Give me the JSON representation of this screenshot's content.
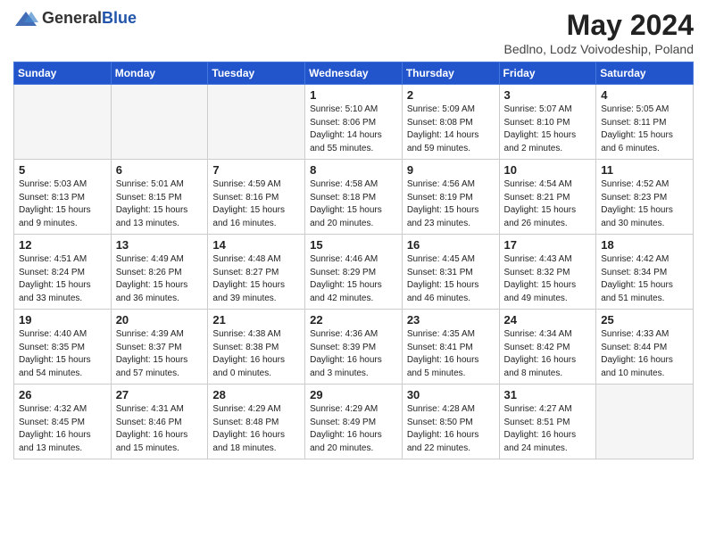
{
  "header": {
    "logo_general": "General",
    "logo_blue": "Blue",
    "month_year": "May 2024",
    "location": "Bedlno, Lodz Voivodeship, Poland"
  },
  "weekdays": [
    "Sunday",
    "Monday",
    "Tuesday",
    "Wednesday",
    "Thursday",
    "Friday",
    "Saturday"
  ],
  "weeks": [
    [
      {
        "day": "",
        "sunrise": "",
        "sunset": "",
        "daylight": "",
        "empty": true
      },
      {
        "day": "",
        "sunrise": "",
        "sunset": "",
        "daylight": "",
        "empty": true
      },
      {
        "day": "",
        "sunrise": "",
        "sunset": "",
        "daylight": "",
        "empty": true
      },
      {
        "day": "1",
        "sunrise": "Sunrise: 5:10 AM",
        "sunset": "Sunset: 8:06 PM",
        "daylight": "Daylight: 14 hours and 55 minutes.",
        "empty": false
      },
      {
        "day": "2",
        "sunrise": "Sunrise: 5:09 AM",
        "sunset": "Sunset: 8:08 PM",
        "daylight": "Daylight: 14 hours and 59 minutes.",
        "empty": false
      },
      {
        "day": "3",
        "sunrise": "Sunrise: 5:07 AM",
        "sunset": "Sunset: 8:10 PM",
        "daylight": "Daylight: 15 hours and 2 minutes.",
        "empty": false
      },
      {
        "day": "4",
        "sunrise": "Sunrise: 5:05 AM",
        "sunset": "Sunset: 8:11 PM",
        "daylight": "Daylight: 15 hours and 6 minutes.",
        "empty": false
      }
    ],
    [
      {
        "day": "5",
        "sunrise": "Sunrise: 5:03 AM",
        "sunset": "Sunset: 8:13 PM",
        "daylight": "Daylight: 15 hours and 9 minutes.",
        "empty": false
      },
      {
        "day": "6",
        "sunrise": "Sunrise: 5:01 AM",
        "sunset": "Sunset: 8:15 PM",
        "daylight": "Daylight: 15 hours and 13 minutes.",
        "empty": false
      },
      {
        "day": "7",
        "sunrise": "Sunrise: 4:59 AM",
        "sunset": "Sunset: 8:16 PM",
        "daylight": "Daylight: 15 hours and 16 minutes.",
        "empty": false
      },
      {
        "day": "8",
        "sunrise": "Sunrise: 4:58 AM",
        "sunset": "Sunset: 8:18 PM",
        "daylight": "Daylight: 15 hours and 20 minutes.",
        "empty": false
      },
      {
        "day": "9",
        "sunrise": "Sunrise: 4:56 AM",
        "sunset": "Sunset: 8:19 PM",
        "daylight": "Daylight: 15 hours and 23 minutes.",
        "empty": false
      },
      {
        "day": "10",
        "sunrise": "Sunrise: 4:54 AM",
        "sunset": "Sunset: 8:21 PM",
        "daylight": "Daylight: 15 hours and 26 minutes.",
        "empty": false
      },
      {
        "day": "11",
        "sunrise": "Sunrise: 4:52 AM",
        "sunset": "Sunset: 8:23 PM",
        "daylight": "Daylight: 15 hours and 30 minutes.",
        "empty": false
      }
    ],
    [
      {
        "day": "12",
        "sunrise": "Sunrise: 4:51 AM",
        "sunset": "Sunset: 8:24 PM",
        "daylight": "Daylight: 15 hours and 33 minutes.",
        "empty": false
      },
      {
        "day": "13",
        "sunrise": "Sunrise: 4:49 AM",
        "sunset": "Sunset: 8:26 PM",
        "daylight": "Daylight: 15 hours and 36 minutes.",
        "empty": false
      },
      {
        "day": "14",
        "sunrise": "Sunrise: 4:48 AM",
        "sunset": "Sunset: 8:27 PM",
        "daylight": "Daylight: 15 hours and 39 minutes.",
        "empty": false
      },
      {
        "day": "15",
        "sunrise": "Sunrise: 4:46 AM",
        "sunset": "Sunset: 8:29 PM",
        "daylight": "Daylight: 15 hours and 42 minutes.",
        "empty": false
      },
      {
        "day": "16",
        "sunrise": "Sunrise: 4:45 AM",
        "sunset": "Sunset: 8:31 PM",
        "daylight": "Daylight: 15 hours and 46 minutes.",
        "empty": false
      },
      {
        "day": "17",
        "sunrise": "Sunrise: 4:43 AM",
        "sunset": "Sunset: 8:32 PM",
        "daylight": "Daylight: 15 hours and 49 minutes.",
        "empty": false
      },
      {
        "day": "18",
        "sunrise": "Sunrise: 4:42 AM",
        "sunset": "Sunset: 8:34 PM",
        "daylight": "Daylight: 15 hours and 51 minutes.",
        "empty": false
      }
    ],
    [
      {
        "day": "19",
        "sunrise": "Sunrise: 4:40 AM",
        "sunset": "Sunset: 8:35 PM",
        "daylight": "Daylight: 15 hours and 54 minutes.",
        "empty": false
      },
      {
        "day": "20",
        "sunrise": "Sunrise: 4:39 AM",
        "sunset": "Sunset: 8:37 PM",
        "daylight": "Daylight: 15 hours and 57 minutes.",
        "empty": false
      },
      {
        "day": "21",
        "sunrise": "Sunrise: 4:38 AM",
        "sunset": "Sunset: 8:38 PM",
        "daylight": "Daylight: 16 hours and 0 minutes.",
        "empty": false
      },
      {
        "day": "22",
        "sunrise": "Sunrise: 4:36 AM",
        "sunset": "Sunset: 8:39 PM",
        "daylight": "Daylight: 16 hours and 3 minutes.",
        "empty": false
      },
      {
        "day": "23",
        "sunrise": "Sunrise: 4:35 AM",
        "sunset": "Sunset: 8:41 PM",
        "daylight": "Daylight: 16 hours and 5 minutes.",
        "empty": false
      },
      {
        "day": "24",
        "sunrise": "Sunrise: 4:34 AM",
        "sunset": "Sunset: 8:42 PM",
        "daylight": "Daylight: 16 hours and 8 minutes.",
        "empty": false
      },
      {
        "day": "25",
        "sunrise": "Sunrise: 4:33 AM",
        "sunset": "Sunset: 8:44 PM",
        "daylight": "Daylight: 16 hours and 10 minutes.",
        "empty": false
      }
    ],
    [
      {
        "day": "26",
        "sunrise": "Sunrise: 4:32 AM",
        "sunset": "Sunset: 8:45 PM",
        "daylight": "Daylight: 16 hours and 13 minutes.",
        "empty": false
      },
      {
        "day": "27",
        "sunrise": "Sunrise: 4:31 AM",
        "sunset": "Sunset: 8:46 PM",
        "daylight": "Daylight: 16 hours and 15 minutes.",
        "empty": false
      },
      {
        "day": "28",
        "sunrise": "Sunrise: 4:29 AM",
        "sunset": "Sunset: 8:48 PM",
        "daylight": "Daylight: 16 hours and 18 minutes.",
        "empty": false
      },
      {
        "day": "29",
        "sunrise": "Sunrise: 4:29 AM",
        "sunset": "Sunset: 8:49 PM",
        "daylight": "Daylight: 16 hours and 20 minutes.",
        "empty": false
      },
      {
        "day": "30",
        "sunrise": "Sunrise: 4:28 AM",
        "sunset": "Sunset: 8:50 PM",
        "daylight": "Daylight: 16 hours and 22 minutes.",
        "empty": false
      },
      {
        "day": "31",
        "sunrise": "Sunrise: 4:27 AM",
        "sunset": "Sunset: 8:51 PM",
        "daylight": "Daylight: 16 hours and 24 minutes.",
        "empty": false
      },
      {
        "day": "",
        "sunrise": "",
        "sunset": "",
        "daylight": "",
        "empty": true
      }
    ]
  ]
}
